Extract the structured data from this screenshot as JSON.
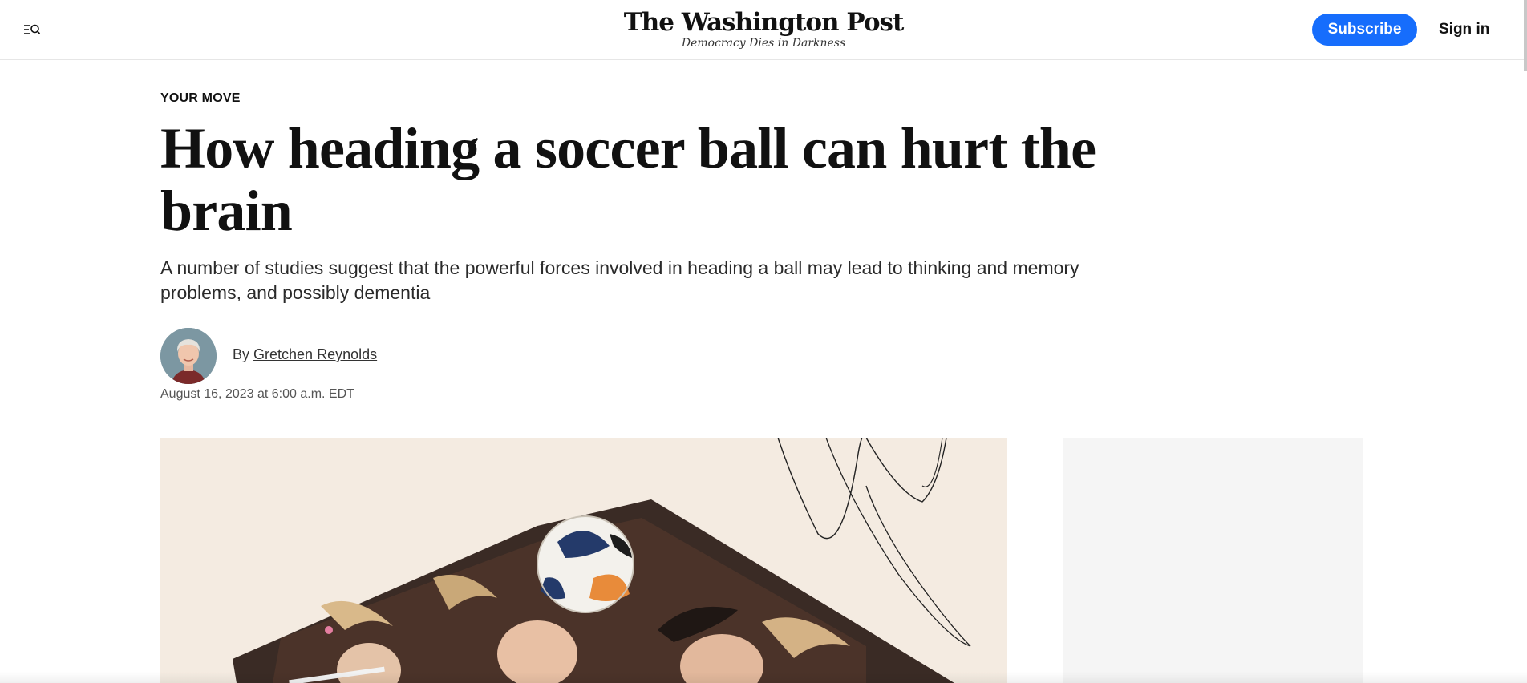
{
  "header": {
    "brand": "The Washington Post",
    "tagline": "Democracy Dies in Darkness",
    "subscribe_label": "Subscribe",
    "signin_label": "Sign in",
    "menu_icon": "menu-search-icon",
    "accent_color": "#166dfc"
  },
  "article": {
    "kicker": "YOUR MOVE",
    "headline": "How heading a soccer ball can hurt the brain",
    "dek": "A number of studies suggest that the powerful forces involved in heading a ball may lead to thinking and memory problems, and possibly dementia",
    "byline_prefix": "By",
    "author": "Gretchen Reynolds",
    "timestamp": "August 16, 2023 at 6:00 a.m. EDT"
  },
  "hero": {
    "background_color": "#f4ebe1"
  }
}
